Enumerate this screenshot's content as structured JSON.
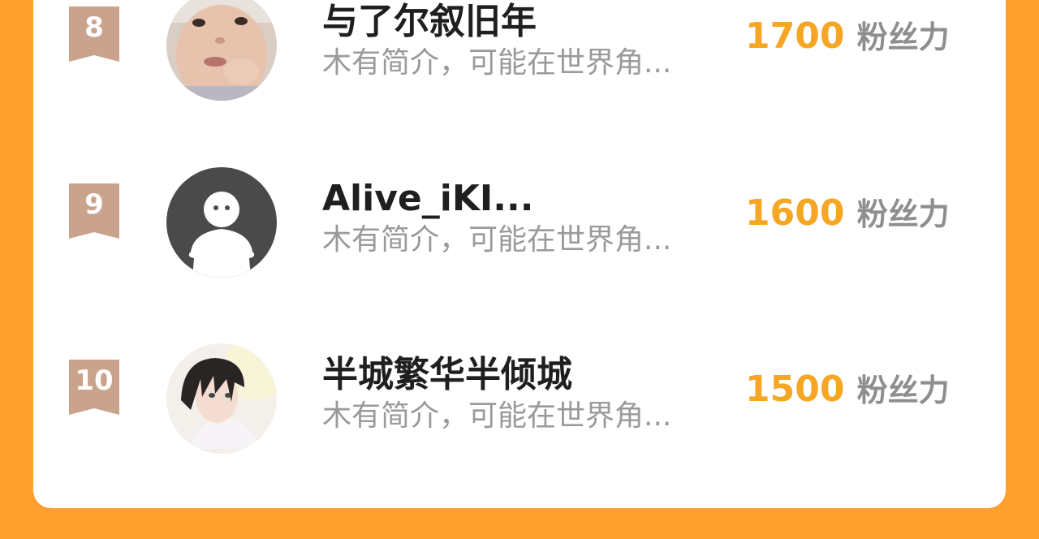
{
  "colors": {
    "background": "#FF9F2E",
    "card": "#FFFFFF",
    "badge": "#C9A38C",
    "fans_number": "#F5A623",
    "name_text": "#1F1F1F",
    "bio_text": "#9A9A9A"
  },
  "rankings": [
    {
      "rank": "8",
      "name": "与了尔叙旧年",
      "bio": "木有简介，可能在世界角...",
      "fans": "1700",
      "fans_unit": "粉丝力",
      "avatar": "baby-photo-avatar"
    },
    {
      "rank": "9",
      "name": "Alive_iKI...",
      "bio": "木有简介，可能在世界角...",
      "fans": "1600",
      "fans_unit": "粉丝力",
      "avatar": "default-ghost-avatar"
    },
    {
      "rank": "10",
      "name": "半城繁华半倾城",
      "bio": "木有简介，可能在世界角...",
      "fans": "1500",
      "fans_unit": "粉丝力",
      "avatar": "anime-boy-avatar"
    }
  ]
}
